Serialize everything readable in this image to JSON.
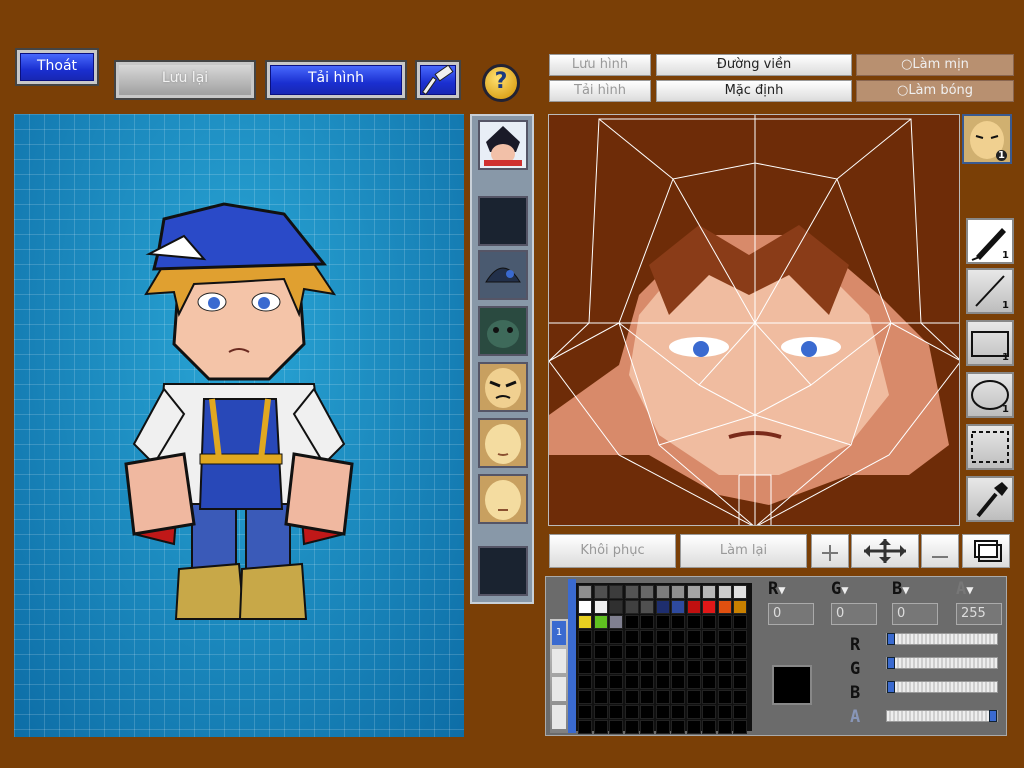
{
  "toolbar": {
    "exit": "Thoát",
    "save": "Lưu lại",
    "reload": "Tải hình",
    "help_icon": "?"
  },
  "editor": {
    "save_image": "Lưu hình",
    "load_image": "Tải hình",
    "outline": "Đường viền",
    "default": "Mặc định",
    "smooth": "Làm mịn",
    "shine": "Làm bóng",
    "restore": "Khôi phục",
    "redo": "Làm lại"
  },
  "tools": [
    {
      "name": "pen-tool-icon",
      "count": "1"
    },
    {
      "name": "line-tool-icon",
      "count": "1"
    },
    {
      "name": "rect-tool-icon",
      "count": "1"
    },
    {
      "name": "ellipse-tool-icon",
      "count": "1"
    },
    {
      "name": "select-tool-icon",
      "count": ""
    },
    {
      "name": "eyedropper-tool-icon",
      "count": ""
    }
  ],
  "preview_count": "1",
  "color": {
    "r": "0",
    "g": "0",
    "b": "0",
    "a": "255",
    "labels": {
      "r": "R",
      "g": "G",
      "b": "B",
      "a": "A"
    },
    "current": "#000000",
    "slider_levels": {
      "r": 0,
      "g": 0,
      "b": 0,
      "a": 1
    }
  },
  "palette_colors": [
    "#8e8e8e",
    "#505050",
    "#3c3c3c",
    "#545454",
    "#686868",
    "#7c7c7c",
    "#909090",
    "#a4a4a4",
    "#b8b8b8",
    "#cccccc",
    "#e0e0e0",
    "#ffffff",
    "#eeeeee",
    "#303030",
    "#404040",
    "#505050",
    "#1e2e6e",
    "#2e4a9e",
    "#c01010",
    "#e01818",
    "#e05010",
    "#c88000",
    "#e8d020",
    "#60c020",
    "#808090"
  ],
  "colors": {
    "background": "#7a3f06",
    "accent_blue": "#1a2fd0"
  }
}
